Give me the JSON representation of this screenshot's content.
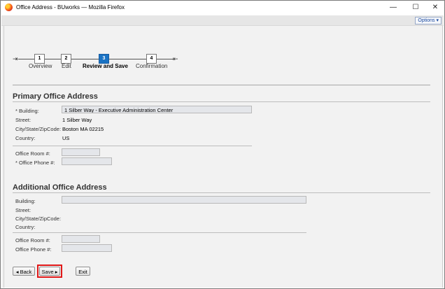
{
  "window": {
    "title": "Office Address - BUworks — Mozilla Firefox",
    "minimize_glyph": "—",
    "maximize_glyph": "☐",
    "close_glyph": "✕"
  },
  "toolbar": {
    "options_label": "Options ▾"
  },
  "stepper": {
    "steps": [
      {
        "number": "1",
        "label": "Overview"
      },
      {
        "number": "2",
        "label": "Edit"
      },
      {
        "number": "3",
        "label": "Review and Save"
      },
      {
        "number": "4",
        "label": "Confirmation"
      }
    ],
    "active_step": 3
  },
  "primary": {
    "title": "Primary Office Address",
    "building_label": "* Building:",
    "building_value": "1 Silber Way - Executive Administration Center",
    "street_label": "Street:",
    "street_value": "1   Silber Way",
    "city_label": "City/State/ZipCode:",
    "city_value": "Boston   MA   02215",
    "country_label": "Country:",
    "country_value": "US",
    "room_label": "Office Room #:",
    "room_value": "",
    "phone_label": "* Office Phone #:",
    "phone_value": ""
  },
  "additional": {
    "title": "Additional Office Address",
    "building_label": "Building:",
    "building_value": "",
    "street_label": "Street:",
    "city_label": "City/State/ZipCode:",
    "country_label": "Country:",
    "room_label": "Office Room #:",
    "room_value": "",
    "phone_label": "Office Phone #:",
    "phone_value": ""
  },
  "actions": {
    "back_label": "◂ Back",
    "save_label": "Save ▸",
    "exit_label": "Exit"
  },
  "colors": {
    "accent": "#1a73c4",
    "highlight": "#e01818"
  }
}
